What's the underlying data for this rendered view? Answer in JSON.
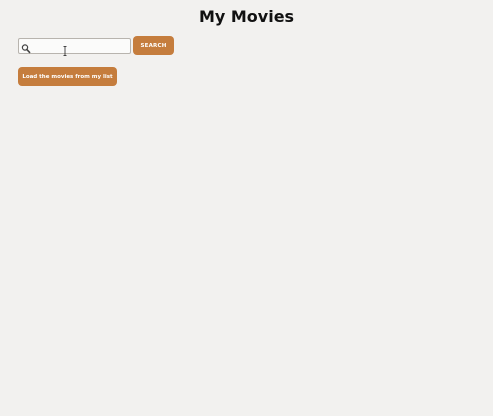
{
  "header": {
    "title": "My Movies"
  },
  "search": {
    "placeholder": "",
    "value": "",
    "icon": "search-icon",
    "button_label": "SEARCH"
  },
  "actions": {
    "load_label": "Load the movies from my list"
  },
  "colors": {
    "accent": "#c57d3d",
    "background": "#f2f1ef"
  }
}
